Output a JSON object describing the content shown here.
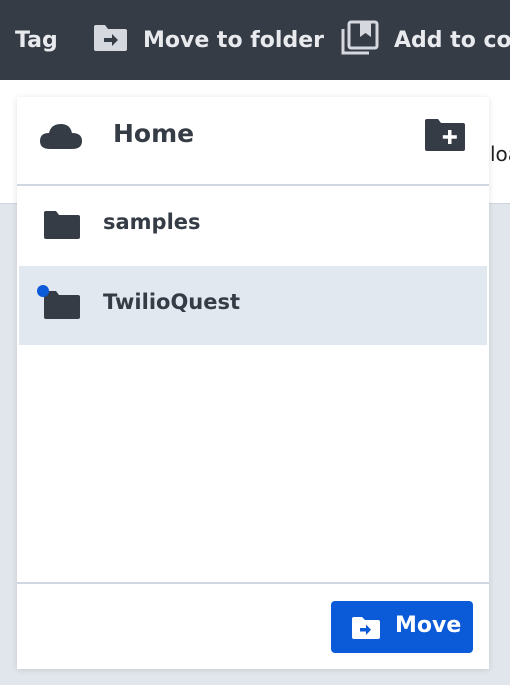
{
  "toolbar": {
    "tag_label": "Tag",
    "move_label": "Move to folder",
    "add_label": "Add to coll"
  },
  "background": {
    "peek_text": "loa"
  },
  "dialog": {
    "header": {
      "title": "Home"
    },
    "folders": [
      {
        "name": "samples",
        "selected": false
      },
      {
        "name": "TwilioQuest",
        "selected": true
      }
    ],
    "move_button": "Move"
  },
  "colors": {
    "toolbar_bg": "#363c46",
    "accent": "#0b5ad8",
    "selected_row": "#e2e8ef",
    "icon_dark": "#363c46"
  },
  "icons": [
    "folder-move-icon",
    "collection-icon",
    "cloud-icon",
    "new-folder-icon",
    "folder-icon"
  ]
}
